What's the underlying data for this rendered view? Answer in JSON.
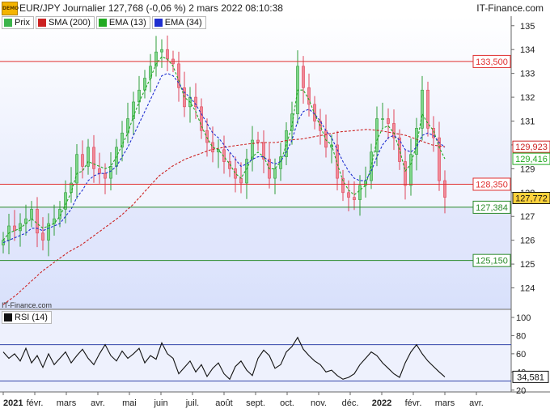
{
  "header": {
    "title": "EUR/JPY Journalier 127,768 (-0,06 %) 2 mars 2022 08:10:38",
    "site": "IT-Finance.com",
    "badge": "DEMO"
  },
  "legend": {
    "items": [
      {
        "label": "Prix",
        "color": "#3cb44b"
      },
      {
        "label": "SMA (200)",
        "color": "#cc2222"
      },
      {
        "label": "EMA (13)",
        "color": "#22aa22"
      },
      {
        "label": "EMA (34)",
        "color": "#1f2fd0"
      }
    ]
  },
  "footer_credit": "IT-Finance.com",
  "rsi_legend": {
    "label": "RSI (14)",
    "color": "#111111"
  },
  "chart_data": [
    {
      "type": "line",
      "title": "EUR/JPY Journalier",
      "x_ticks": [
        "2021",
        "févr.",
        "mars",
        "avr.",
        "mai",
        "juin",
        "juil.",
        "août",
        "sept.",
        "oct.",
        "nov.",
        "déc.",
        "2022",
        "févr.",
        "mars",
        "avr."
      ],
      "ylim": [
        123.1,
        135.4
      ],
      "y_ticks": [
        124,
        125,
        126,
        127,
        128,
        129,
        130,
        131,
        132,
        133,
        134,
        135
      ],
      "grid": false,
      "series": [
        {
          "name": "Prix",
          "color": "#3cb44b",
          "values": [
            126.0,
            126.6,
            126.4,
            126.7,
            126.9,
            127.3,
            126.3,
            126.0,
            126.7,
            126.9,
            127.3,
            128.0,
            128.4,
            129.6,
            129.1,
            129.9,
            129.0,
            128.8,
            128.6,
            129.1,
            129.9,
            130.5,
            131.1,
            131.8,
            132.3,
            132.8,
            133.3,
            133.9,
            134.0,
            133.6,
            133.4,
            132.4,
            131.6,
            132.0,
            131.6,
            130.6,
            130.1,
            129.7,
            129.8,
            129.3,
            129.0,
            128.6,
            128.4,
            129.4,
            130.2,
            130.1,
            129.4,
            128.6,
            129.0,
            129.5,
            130.6,
            131.3,
            133.3,
            132.4,
            131.7,
            131.0,
            130.6,
            129.9,
            130.0,
            128.6,
            128.0,
            127.8,
            127.7,
            128.3,
            128.5,
            129.7,
            131.1,
            131.1,
            130.9,
            130.3,
            129.3,
            128.3,
            129.6,
            130.7,
            132.3,
            130.7,
            130.3,
            128.5,
            127.8
          ]
        },
        {
          "name": "SMA (200)",
          "color": "#cc2222",
          "values": [
            123.3,
            123.7,
            124.2,
            124.7,
            125.1,
            125.5,
            125.8,
            126.2,
            126.6,
            127.0,
            127.5,
            128.1,
            128.7,
            129.1,
            129.4,
            129.6,
            129.8,
            129.9,
            129.98,
            130.05,
            130.1,
            130.1,
            130.2,
            130.25,
            130.35,
            130.45,
            130.55,
            130.6,
            130.65,
            130.6,
            130.5,
            130.4,
            130.2,
            130.0,
            129.923
          ]
        },
        {
          "name": "EMA (13)",
          "color": "#22aa22",
          "values": [
            126.0,
            126.3,
            126.4,
            126.5,
            126.7,
            126.9,
            126.7,
            126.5,
            126.6,
            126.7,
            127.0,
            127.5,
            128.0,
            128.8,
            128.9,
            129.3,
            129.2,
            129.1,
            129.0,
            129.1,
            129.5,
            130.0,
            130.5,
            131.2,
            131.8,
            132.3,
            132.8,
            133.4,
            133.7,
            133.6,
            133.3,
            132.7,
            132.0,
            131.8,
            131.4,
            130.8,
            130.3,
            129.9,
            129.8,
            129.5,
            129.2,
            128.8,
            128.6,
            129.0,
            129.5,
            129.7,
            129.5,
            129.0,
            129.0,
            129.3,
            130.0,
            130.8,
            132.3,
            132.3,
            131.9,
            131.3,
            130.8,
            130.2,
            130.0,
            129.2,
            128.5,
            128.1,
            127.9,
            128.1,
            128.3,
            129.1,
            130.2,
            130.7,
            130.8,
            130.5,
            129.8,
            128.9,
            129.2,
            130.0,
            131.3,
            130.9,
            130.6,
            129.9,
            129.416
          ]
        },
        {
          "name": "EMA (34)",
          "color": "#1f2fd0",
          "values": [
            125.9,
            126.0,
            126.1,
            126.2,
            126.3,
            126.5,
            126.5,
            126.4,
            126.5,
            126.6,
            126.7,
            127.0,
            127.3,
            127.8,
            128.1,
            128.5,
            128.7,
            128.8,
            128.8,
            128.9,
            129.1,
            129.5,
            129.9,
            130.4,
            130.9,
            131.4,
            131.9,
            132.4,
            132.9,
            133.0,
            132.9,
            132.6,
            132.2,
            132.0,
            131.7,
            131.3,
            130.9,
            130.5,
            130.3,
            130.0,
            129.7,
            129.4,
            129.1,
            129.2,
            129.4,
            129.5,
            129.5,
            129.3,
            129.2,
            129.3,
            129.7,
            130.2,
            131.0,
            131.4,
            131.5,
            131.3,
            131.0,
            130.6,
            130.3,
            129.8,
            129.3,
            128.9,
            128.6,
            128.5,
            128.5,
            128.9,
            129.5,
            130.0,
            130.3,
            130.4,
            130.2,
            129.8,
            129.7,
            129.9,
            130.4,
            130.5,
            130.4,
            130.1,
            129.9
          ]
        }
      ],
      "horizontal_levels": [
        {
          "label": "133,500",
          "value": 133.5,
          "color": "#e03030"
        },
        {
          "label": "128,350",
          "value": 128.35,
          "color": "#e03030"
        },
        {
          "label": "127,384",
          "value": 127.384,
          "color": "#2a8a2a"
        },
        {
          "label": "125,150",
          "value": 125.15,
          "color": "#2a8a2a"
        }
      ],
      "price_tags": [
        {
          "label": "129,923",
          "value": 129.923,
          "color": "#cc2222",
          "bg": "#ffffff"
        },
        {
          "label": "129,416",
          "value": 129.416,
          "color": "#22aa22",
          "bg": "#ffffff"
        },
        {
          "label": "127,772",
          "value": 127.772,
          "color": "#111111",
          "bg": "#ffd23c"
        }
      ]
    },
    {
      "type": "line",
      "title": "RSI (14)",
      "ylim": [
        18,
        108
      ],
      "y_ticks": [
        20,
        40,
        60,
        80,
        100
      ],
      "levels": [
        70,
        30
      ],
      "series": [
        {
          "name": "RSI (14)",
          "color": "#111111",
          "values": [
            62,
            55,
            60,
            52,
            66,
            50,
            58,
            45,
            60,
            48,
            55,
            62,
            50,
            58,
            65,
            55,
            48,
            60,
            70,
            58,
            52,
            63,
            55,
            60,
            66,
            50,
            58,
            54,
            72,
            60,
            55,
            38,
            45,
            52,
            40,
            48,
            35,
            44,
            50,
            38,
            32,
            46,
            52,
            42,
            36,
            55,
            64,
            58,
            44,
            48,
            62,
            68,
            78,
            65,
            58,
            52,
            48,
            40,
            42,
            36,
            32,
            34,
            38,
            48,
            55,
            62,
            58,
            50,
            44,
            38,
            34,
            50,
            62,
            70,
            60,
            52,
            46,
            40,
            34.581
          ]
        }
      ],
      "price_tags": [
        {
          "label": "34,581",
          "value": 34.581,
          "color": "#111111",
          "bg": "#ffffff"
        }
      ]
    }
  ]
}
